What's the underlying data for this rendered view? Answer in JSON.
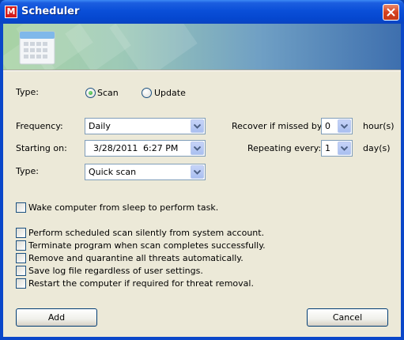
{
  "window": {
    "title": "Scheduler",
    "app_icon_letter": "M"
  },
  "type_section": {
    "label": "Type:",
    "options": [
      {
        "label": "Scan",
        "selected": true
      },
      {
        "label": "Update",
        "selected": false
      }
    ]
  },
  "frequency": {
    "label": "Frequency:",
    "value": "Daily"
  },
  "starting_on": {
    "label": "Starting on:",
    "date": "3/28/2011",
    "time": "6:27 PM"
  },
  "scan_type": {
    "label": "Type:",
    "value": "Quick scan"
  },
  "recover": {
    "label": "Recover if missed by:",
    "value": "0",
    "unit": "hour(s)"
  },
  "repeating": {
    "label": "Repeating every:",
    "value": "1",
    "unit": "day(s)"
  },
  "wake": {
    "label": "Wake computer from sleep to perform task.",
    "checked": false
  },
  "options": [
    {
      "label": "Perform scheduled scan silently from system account.",
      "checked": false
    },
    {
      "label": "Terminate program when scan completes successfully.",
      "checked": false
    },
    {
      "label": "Remove and quarantine all threats automatically.",
      "checked": false
    },
    {
      "label": "Save log file regardless of user settings.",
      "checked": false
    },
    {
      "label": "Restart the computer if required for threat removal.",
      "checked": false
    }
  ],
  "buttons": {
    "add": "Add",
    "cancel": "Cancel"
  }
}
